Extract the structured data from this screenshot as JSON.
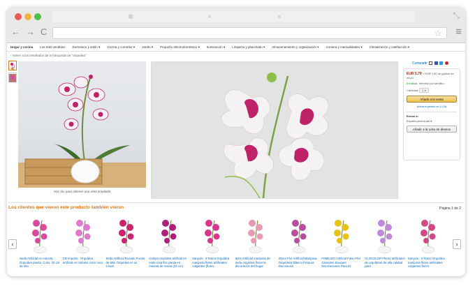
{
  "browser": {
    "tab_close_glyphs": [
      "⊗",
      "×",
      "×"
    ],
    "nav_back": "←",
    "nav_forward": "→",
    "nav_reload": "C",
    "star": "☆",
    "menu": "≡",
    "resize": "⤡"
  },
  "categories": [
    "Hogar y cocina",
    "Los más vendidos",
    "Dormitorio y salón ▾",
    "Cocina y comedor ▾",
    "Jardín ▾",
    "Pequeño electrodoméstico ▾",
    "Iluminación ▾",
    "Limpieza y planchado ▾",
    "Almacenamiento y organización ▾",
    "Costura y manualidades ▾",
    "Climatización y calefacción ▾"
  ],
  "breadcrumb": "‹ Volver a los resultados de la búsqueda de \"orquídea\"",
  "left_image_caption": "Haz clic para obtener una vista ampliada",
  "share": {
    "label": "Compartir"
  },
  "buybox": {
    "price": "EUR 5,79",
    "price_detail": "+ EUR 1,00 de gastos de envío",
    "stock": "En stock.",
    "sold_by": "Vendido por familiko.",
    "quantity_label": "Cantidad:",
    "quantity_value": "1 ▾",
    "add_to_cart": "Añadir a la cesta",
    "one_click": "Activa el pedido en 1-Clic",
    "ship_to_label": "Enviar a:",
    "ship_to_value": "España peninsular ▾",
    "add_to_wishlist": "Añadir a la Lista de deseos"
  },
  "similar": {
    "title": "Los clientes que vieron este producto también vieron",
    "page_indicator": "Página 1 de 2",
    "prev": "‹",
    "next": "›",
    "items": [
      {
        "title": "Seda Artificial en maceta Orquídea planta. Color. 33 cm de alto",
        "color": "#d84a9a"
      },
      {
        "title": "CB Imports - Orquídea artificial en maceta, color rosa",
        "color": "#e07ad0"
      },
      {
        "title": "Seda Artificial Rosado Fucsia de Mini Orquídea en un Cincel",
        "color": "#c9246e"
      },
      {
        "title": "Compo orquídea artificial en seda rosa flor planta en maceta de resina (33 cm)",
        "color": "#b0207a"
      },
      {
        "title": "Sanysis - 3 Ramo Orquídea mariposa flores artificiales colgantes (flores",
        "color": "#d8368c"
      },
      {
        "title": "5pcs Artificial mariposa de seda orquídea flores la decoración del hogar",
        "color": "#e89ab4"
      },
      {
        "title": "20pcs Flor Artificial Mariposa Orquídeas Blanco Púrpura Decoración",
        "color": "#b84ca0"
      },
      {
        "title": "FAMILIZO Artificial Falso Flor Girasoles Bouquet Decoraciones Para El",
        "color": "#e8c21a"
      },
      {
        "title": "CLOCOLOR Flores artificiales de orquídeas de alta calidad para",
        "color": "#c08ad8"
      },
      {
        "title": "Sanysis - 3 Ramo Orquídea mariposa flores artificiales colgantes flores",
        "color": "#d44888"
      }
    ]
  },
  "colors": {
    "accent_orange": "#e47911",
    "link_blue": "#0066c0",
    "price_red": "#b12704",
    "stock_green": "#008a00",
    "orchid_magenta": "#c0226a"
  }
}
